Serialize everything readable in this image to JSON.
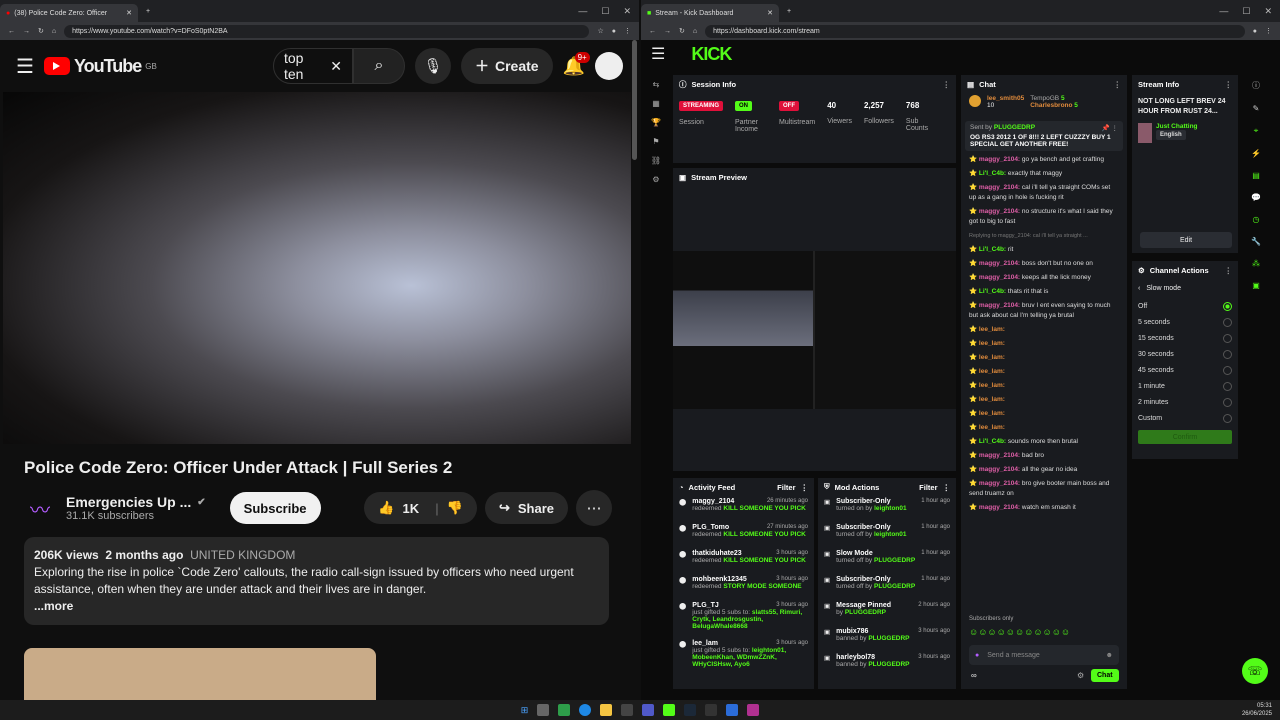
{
  "yt": {
    "tab_title": "(38) Police Code Zero: Officer",
    "url": "https://www.youtube.com/watch?v=DFoS0ptN2BA",
    "logo": "YouTube",
    "region": "GB",
    "search_value": "top ten",
    "create_label": "Create",
    "notif_count": "9+",
    "title": "Police Code Zero: Officer Under Attack | Full Series 2",
    "channel": "Emergencies Up ...",
    "subscribers": "31.1K subscribers",
    "subscribe_label": "Subscribe",
    "likes": "1K",
    "share_label": "Share",
    "views": "206K views",
    "age": "2 months ago",
    "country": "UNITED KINGDOM",
    "description": "Exploring the rise in police `Code Zero' callouts, the radio call-sign issued by officers who need urgent assistance, often when they are under attack and their lives are in danger.",
    "more_label": "...more"
  },
  "kick": {
    "tab_title": "Stream - Kick Dashboard",
    "url": "https://dashboard.kick.com/stream",
    "logo": "KICK",
    "session": {
      "title": "Session Info",
      "streaming": "STREAMING",
      "session_label": "Session",
      "on": "ON",
      "partner_label": "Partner Income",
      "off": "OFF",
      "multistream_label": "Multistream",
      "viewers": "40",
      "viewers_label": "Viewers",
      "followers": "2,257",
      "followers_label": "Followers",
      "subs": "768",
      "subs_label": "Sub Counts"
    },
    "preview_title": "Stream Preview",
    "activity": {
      "title": "Activity Feed",
      "filter": "Filter",
      "items": [
        {
          "name": "maggy_2104",
          "time": "26 minutes ago",
          "action": "redeemed",
          "what": "KILL SOMEONE YOU PICK"
        },
        {
          "name": "PLG_Tomo",
          "time": "27 minutes ago",
          "action": "redeemed",
          "what": "KILL SOMEONE YOU PICK"
        },
        {
          "name": "thatkiduhate23",
          "time": "3 hours ago",
          "action": "redeemed",
          "what": "KILL SOMEONE YOU PICK"
        },
        {
          "name": "mohbeenk12345",
          "time": "3 hours ago",
          "action": "redeemed",
          "what": "STORY MODE SOMEONE"
        },
        {
          "name": "PLG_TJ",
          "time": "3 hours ago",
          "action": "just gifted 5 subs to:",
          "what": "slatts55, Rimuri, Crytk, Leandrosgustin, BelugaWhale8668"
        },
        {
          "name": "lee_lam",
          "time": "3 hours ago",
          "action": "just gifted 5 subs to:",
          "what": "leighton01, MobeenKhan, WDmwZZnK, WHyCISHsw, Ayo6"
        }
      ]
    },
    "mod": {
      "title": "Mod Actions",
      "filter": "Filter",
      "items": [
        {
          "name": "Subscriber-Only",
          "time": "1 hour ago",
          "action": "turned on by",
          "who": "leighton01"
        },
        {
          "name": "Subscriber-Only",
          "time": "1 hour ago",
          "action": "turned off by",
          "who": "leighton01"
        },
        {
          "name": "Slow Mode",
          "time": "1 hour ago",
          "action": "turned off by",
          "who": "PLUGGEDRP"
        },
        {
          "name": "Subscriber-Only",
          "time": "1 hour ago",
          "action": "turned off by",
          "who": "PLUGGEDRP"
        },
        {
          "name": "Message Pinned",
          "time": "2 hours ago",
          "action": "by",
          "who": "PLUGGEDRP"
        },
        {
          "name": "mubix786",
          "time": "3 hours ago",
          "action": "banned by",
          "who": "PLUGGEDRP"
        },
        {
          "name": "harleybol78",
          "time": "3 hours ago",
          "action": "banned by",
          "who": "PLUGGEDRP"
        }
      ]
    },
    "chat": {
      "title": "Chat",
      "top_user": "lee_smith05",
      "top_num": "10",
      "gifter1": "TempoGB",
      "gifter2": "Charlesbrono",
      "g1": "5",
      "g2": "5",
      "pinned_by": "Sent by",
      "pinned_user": "PLUGGEDRP",
      "pinned_text": "OG RS3 2012 1 OF 8!!! 2 LEFT CUZZZY BUY 1 SPECIAL GET ANOTHER FREE!",
      "messages": [
        {
          "u": "maggy_2104:",
          "c": "u1",
          "t": "go ya bench and get crafting"
        },
        {
          "u": "Li'l_C4b:",
          "c": "u2",
          "t": "exactly that maggy"
        },
        {
          "u": "maggy_2104:",
          "c": "u1",
          "t": "cal i'll tell ya straight COMs set up as a gang in hole is fucking rit"
        },
        {
          "u": "maggy_2104:",
          "c": "u1",
          "t": "no structure it's what I said they got to big to fast"
        },
        {
          "u": "Li'l_C4b:",
          "c": "u2",
          "t": "rit"
        },
        {
          "u": "maggy_2104:",
          "c": "u1",
          "t": "boss don't but no one on"
        },
        {
          "u": "maggy_2104:",
          "c": "u1",
          "t": "keeps all the lick money"
        },
        {
          "u": "Li'l_C4b:",
          "c": "u2",
          "t": "thats rit that is"
        },
        {
          "u": "maggy_2104:",
          "c": "u1",
          "t": "bruv I ent even saying to much but ask about cal I'm telling ya brutal"
        },
        {
          "u": "lee_lam:",
          "c": "u3",
          "t": ""
        },
        {
          "u": "lee_lam:",
          "c": "u3",
          "t": ""
        },
        {
          "u": "lee_lam:",
          "c": "u3",
          "t": ""
        },
        {
          "u": "lee_lam:",
          "c": "u3",
          "t": ""
        },
        {
          "u": "lee_lam:",
          "c": "u3",
          "t": ""
        },
        {
          "u": "lee_lam:",
          "c": "u3",
          "t": ""
        },
        {
          "u": "lee_lam:",
          "c": "u3",
          "t": ""
        },
        {
          "u": "lee_lam:",
          "c": "u3",
          "t": ""
        },
        {
          "u": "Li'l_C4b:",
          "c": "u2",
          "t": "sounds more then brutal"
        },
        {
          "u": "maggy_2104:",
          "c": "u1",
          "t": "bad bro"
        },
        {
          "u": "maggy_2104:",
          "c": "u1",
          "t": "all the gear no idea"
        },
        {
          "u": "maggy_2104:",
          "c": "u1",
          "t": "bro give booter main boss and send truamz on"
        },
        {
          "u": "maggy_2104:",
          "c": "u1",
          "t": "watch em smash it"
        }
      ],
      "reply_note": "Replying to maggy_2104: cal i'll tell ya straight ...",
      "subs_only": "Subscribers only",
      "placeholder": "Send a message",
      "send": "Chat"
    },
    "info": {
      "title": "Stream Info",
      "stream_title": "NOT LONG LEFT BREV 24 HOUR FROM RUST 24...",
      "category": "Just Chatting",
      "language": "English",
      "edit": "Edit"
    },
    "actions": {
      "title": "Channel Actions",
      "slow_mode": "Slow mode",
      "options": [
        "Off",
        "5 seconds",
        "15 seconds",
        "30 seconds",
        "45 seconds",
        "1 minute",
        "2 minutes",
        "Custom"
      ],
      "confirm": "Confirm"
    }
  },
  "clock": {
    "time": "05:31",
    "date": "26/06/2025"
  },
  "colors": {
    "kick_green": "#53fc18",
    "yt_red": "#ff0000"
  }
}
